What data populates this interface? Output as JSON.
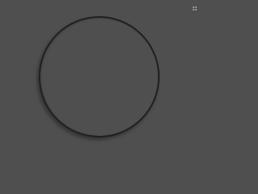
{
  "canvas": {
    "background_color": "#4f4f4f",
    "ring_color": "#202020"
  },
  "overlay": {
    "corner_icon": "grid-icon"
  }
}
